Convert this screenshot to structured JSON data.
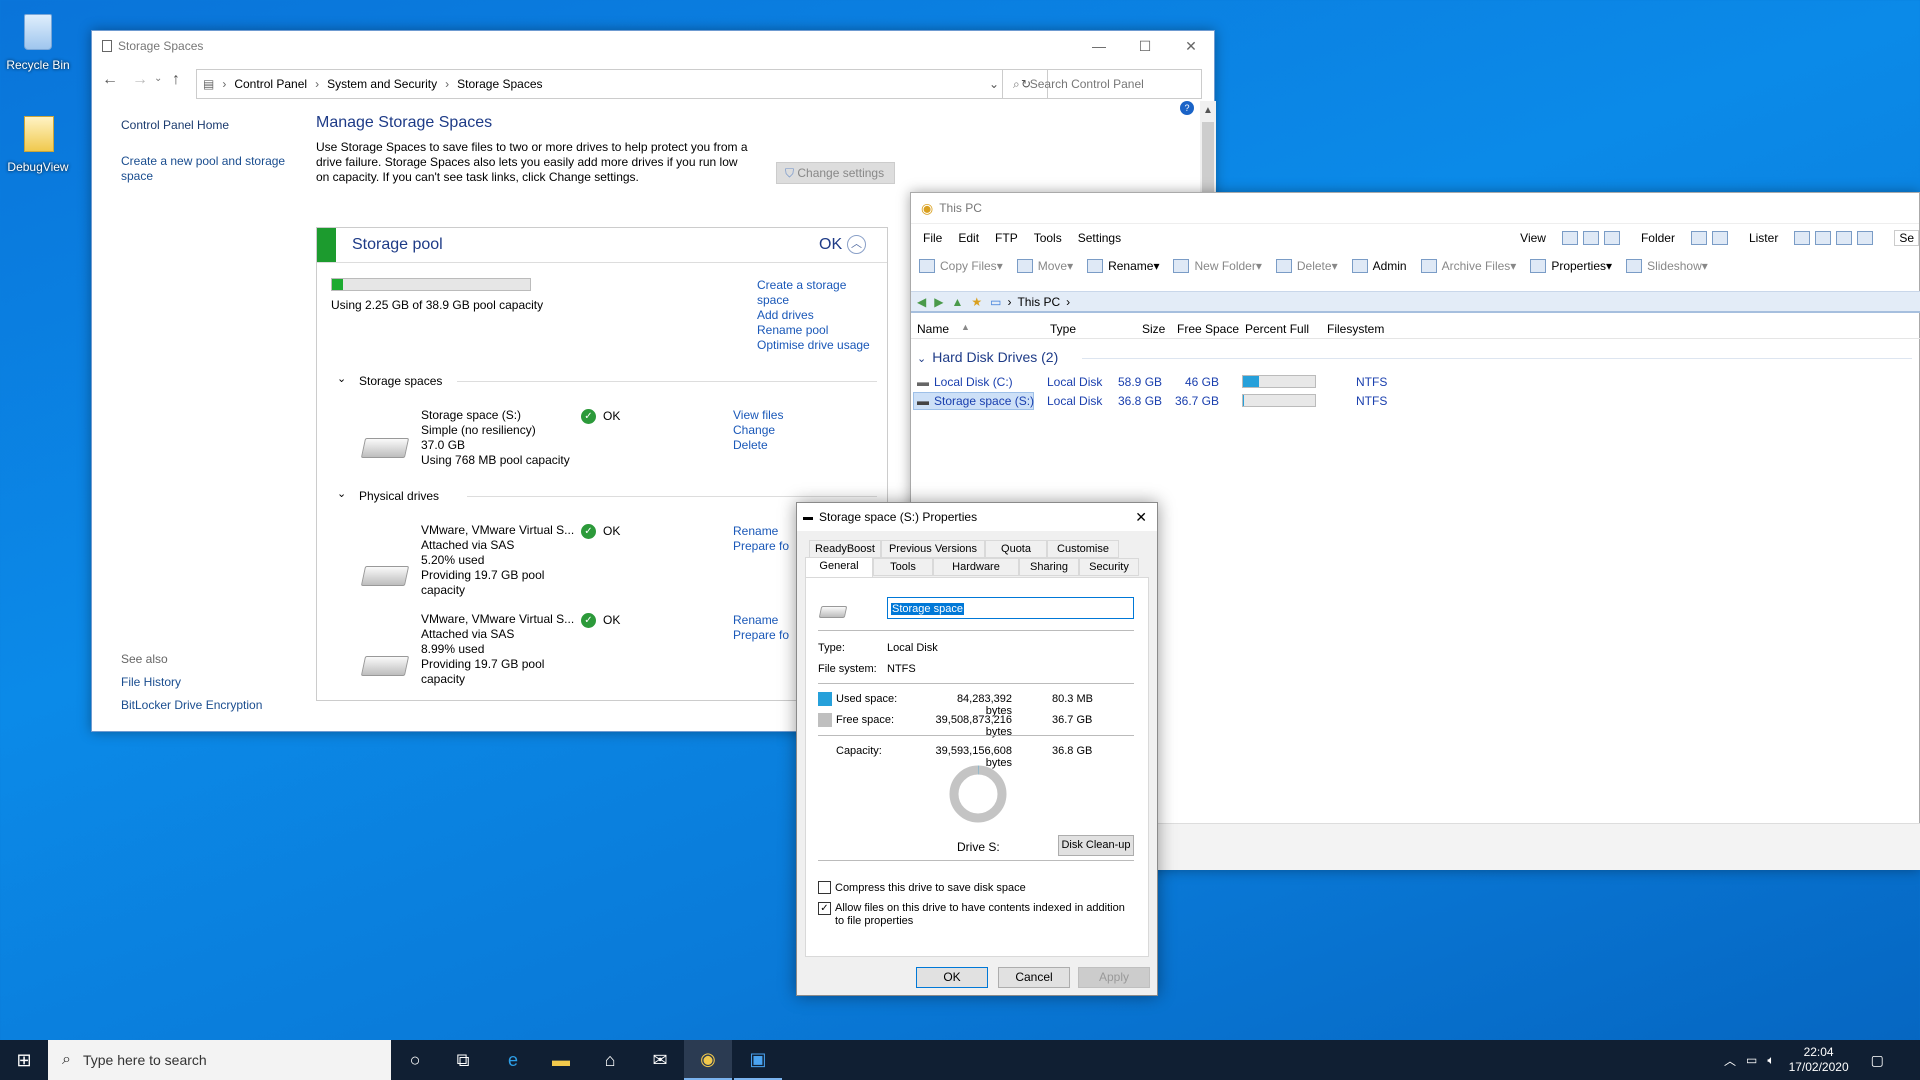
{
  "desktop": {
    "icons": [
      {
        "label": "Recycle Bin",
        "icon": "recycle-bin-icon"
      },
      {
        "label": "DebugView",
        "icon": "folder-icon"
      }
    ]
  },
  "storage_window": {
    "title": "Storage Spaces",
    "breadcrumb": [
      "Control Panel",
      "System and Security",
      "Storage Spaces"
    ],
    "search_placeholder": "Search Control Panel",
    "side_links": {
      "home": "Control Panel Home",
      "create": "Create a new pool and storage space",
      "see_also": "See also",
      "file_history": "File History",
      "bitlocker": "BitLocker Drive Encryption"
    },
    "heading": "Manage Storage Spaces",
    "intro": "Use Storage Spaces to save files to two or more drives to help protect you from a drive failure. Storage Spaces also lets you easily add more drives if you run low on capacity. If you can't see task links, click Change settings.",
    "change_settings": "Change settings",
    "pool": {
      "title": "Storage pool",
      "status": "OK",
      "usage_text": "Using 2.25 GB of 38.9 GB pool capacity",
      "usage_fraction": 0.058,
      "links": [
        "Create a storage space",
        "Add drives",
        "Rename pool",
        "Optimise drive usage"
      ]
    },
    "spaces_header": "Storage spaces",
    "space": {
      "lines": [
        "Storage space (S:)",
        "Simple (no resiliency)",
        "37.0 GB",
        "Using 768 MB pool capacity"
      ],
      "status": "OK",
      "links": [
        "View files",
        "Change",
        "Delete"
      ]
    },
    "physical_header": "Physical drives",
    "drives": [
      {
        "lines": [
          "VMware, VMware Virtual S...",
          "Attached via SAS",
          "5.20% used",
          "Providing 19.7 GB pool",
          "capacity"
        ],
        "status": "OK",
        "links": [
          "Rename",
          "Prepare fo"
        ]
      },
      {
        "lines": [
          "VMware, VMware Virtual S...",
          "Attached via SAS",
          "8.99% used",
          "Providing 19.7 GB pool",
          "capacity"
        ],
        "status": "OK",
        "links": [
          "Rename",
          "Prepare fo"
        ]
      }
    ]
  },
  "explorer": {
    "title": "This PC",
    "menu": [
      "File",
      "Edit",
      "FTP",
      "Tools",
      "Settings"
    ],
    "menu_right": [
      "View",
      "Folder",
      "Lister",
      "Se"
    ],
    "toolbar": [
      "Copy Files",
      "Move",
      "Rename",
      "New Folder",
      "Delete",
      "Admin",
      "Archive Files",
      "Properties",
      "Slideshow"
    ],
    "path": "This PC",
    "columns": [
      "Name",
      "Type",
      "Size",
      "Free Space",
      "Percent Full",
      "Filesystem"
    ],
    "group": "Hard Disk Drives (2)",
    "rows": [
      {
        "name": "Local Disk (C:)",
        "type": "Local Disk",
        "size": "58.9 GB",
        "free": "46 GB",
        "percent": 0.22,
        "fs": "NTFS"
      },
      {
        "name": "Storage space (S:)",
        "type": "Local Disk",
        "size": "36.8 GB",
        "free": "36.7 GB",
        "percent": 0.002,
        "fs": "NTFS"
      }
    ]
  },
  "dialog": {
    "title": "Storage space (S:) Properties",
    "tabs_top": [
      "ReadyBoost",
      "Previous Versions",
      "Quota",
      "Customise"
    ],
    "tabs_bottom": [
      "General",
      "Tools",
      "Hardware",
      "Sharing",
      "Security"
    ],
    "name_value": "Storage space",
    "type_label": "Type:",
    "type_value": "Local Disk",
    "fs_label": "File system:",
    "fs_value": "NTFS",
    "used_label": "Used space:",
    "used_bytes": "84,283,392 bytes",
    "used_size": "80.3 MB",
    "free_label": "Free space:",
    "free_bytes": "39,508,873,216 bytes",
    "free_size": "36.7 GB",
    "cap_label": "Capacity:",
    "cap_bytes": "39,593,156,608 bytes",
    "cap_size": "36.8 GB",
    "drive_label": "Drive S:",
    "cleanup": "Disk Clean-up",
    "compress": "Compress this drive to save disk space",
    "index": "Allow files on this drive to have contents indexed in addition to file properties",
    "ok": "OK",
    "cancel": "Cancel",
    "apply": "Apply",
    "used_color": "#26a0da",
    "free_color": "#bfbfbf"
  },
  "taskbar": {
    "search": "Type here to search",
    "time": "22:04",
    "date": "17/02/2020"
  }
}
